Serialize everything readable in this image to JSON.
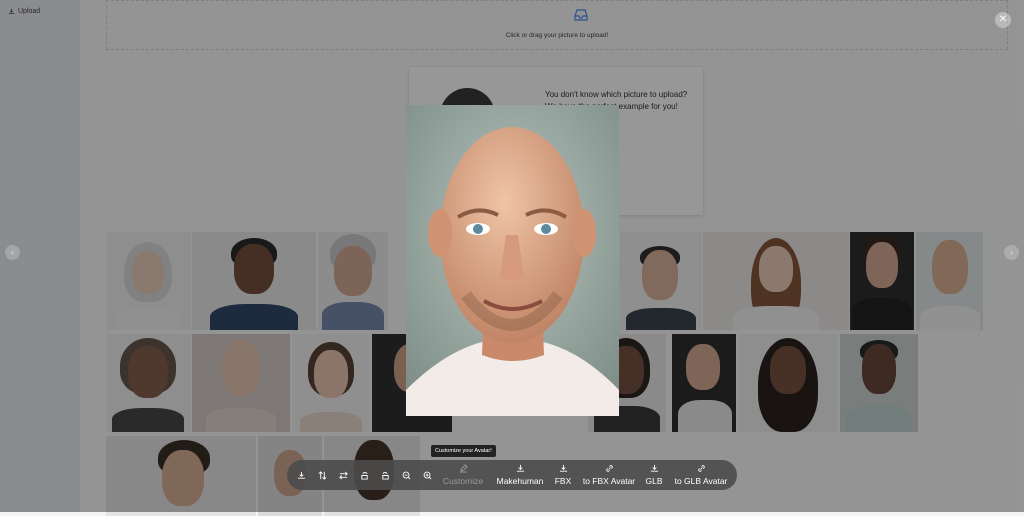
{
  "sidebar": {
    "upload_label": "Upload",
    "upload_icon": "download-icon"
  },
  "dropzone": {
    "icon": "inbox-icon",
    "text": "Click or drag your picture to upload!"
  },
  "example": {
    "text": "You don't know which picture to upload? We have the perfect example for you! ...assport guy!"
  },
  "viewer": {
    "close_icon": "close-icon",
    "prev_icon": "chevron-left-icon",
    "next_icon": "chevron-right-icon",
    "tooltip": "Customize your Avatar!",
    "tool_icons": [
      "download-icon",
      "swap-vertical-icon",
      "swap-horizontal-icon",
      "rotate-left-icon",
      "rotate-right-icon",
      "zoom-out-icon",
      "zoom-in-icon"
    ],
    "buttons": [
      {
        "label": "Customize",
        "icon": "edit-icon",
        "disabled": true
      },
      {
        "label": "Makehuman",
        "icon": "download-icon"
      },
      {
        "label": "FBX",
        "icon": "download-icon"
      },
      {
        "label": "to FBX Avatar",
        "icon": "link-icon"
      },
      {
        "label": "GLB",
        "icon": "download-icon"
      },
      {
        "label": "to GLB Avatar",
        "icon": "link-icon"
      }
    ]
  },
  "colors": {
    "overlay": "#191919",
    "toolbar": "#4b4b4b",
    "sidebar": "#e9ecf3"
  }
}
